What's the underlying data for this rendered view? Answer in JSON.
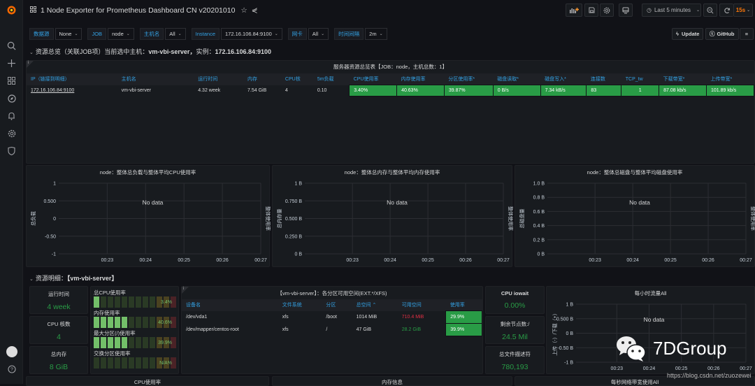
{
  "app": {
    "title": "1 Node Exporter for Prometheus Dashboard CN v20201010"
  },
  "toolbar": {
    "add_panel_icon": "add-panel-icon",
    "save_icon": "save-icon",
    "settings_icon": "gear-icon",
    "tv_icon": "tv-icon",
    "time_range": "Last 5 minutes",
    "zoom_out_icon": "zoom-out-icon",
    "refresh_icon": "refresh-icon",
    "refresh_interval": "15s",
    "refresh_color": "#ff780a"
  },
  "sidebar": {
    "items": [
      {
        "icon": "search-icon"
      },
      {
        "icon": "plus-icon"
      },
      {
        "icon": "dashboards-icon"
      },
      {
        "icon": "explore-icon"
      },
      {
        "icon": "bell-icon"
      },
      {
        "icon": "gear-icon"
      },
      {
        "icon": "shield-icon"
      }
    ],
    "bottom": [
      {
        "icon": "avatar"
      },
      {
        "icon": "help-icon"
      }
    ]
  },
  "variables": [
    {
      "label": "数据源",
      "value": "None"
    },
    {
      "label": "JOB",
      "value": "node"
    },
    {
      "label": "主机名",
      "value": "All"
    },
    {
      "label": "Instance",
      "value": "172.16.106.84:9100"
    },
    {
      "label": "网卡",
      "value": "All"
    },
    {
      "label": "时间间隔",
      "value": "2m"
    }
  ],
  "links": {
    "update": "Update",
    "github": "GitHub"
  },
  "row1": {
    "title_prefix": "资源总览（关联JOB项）当前选中主机：",
    "title_host": "vm-vbi-server，",
    "title_mid": "实例：",
    "title_instance": "172.16.106.84:9100"
  },
  "overview_table": {
    "title": "服务器资源总览表【JOB：node，主机总数：1】",
    "columns": [
      "IP（链接到明细）",
      "主机名",
      "运行时间",
      "内存",
      "CPU核",
      "5m负载",
      "CPU使用率",
      "内存使用率",
      "分区使用率*",
      "磁盘读取*",
      "磁盘写入*",
      "连接数",
      "TCP_tw",
      "下载带宽*",
      "上传带宽*"
    ],
    "rows": [
      [
        "172.16.106.84:9100",
        "vm-vbi-server",
        "4.32 week",
        "7.54 GiB",
        "4",
        "0.10",
        "3.40%",
        "40.63%",
        "39.87%",
        "0 B/s",
        "7.34 kB/s",
        "83",
        "1",
        "87.08 kb/s",
        "101.89 kb/s"
      ]
    ]
  },
  "chart_data": [
    {
      "type": "line",
      "title": "node：整体总负载与整体平均CPU使用率",
      "ylabel": "总负载",
      "y2label": "整体使用率",
      "yticks": [
        "1",
        "0.500",
        "0",
        "-0.50",
        "-1"
      ],
      "ylim": [
        -1,
        1
      ],
      "x": [
        "00:23",
        "00:24",
        "00:25",
        "00:26",
        "00:27"
      ],
      "series": [],
      "no_data": "No data"
    },
    {
      "type": "line",
      "title": "node：整体总内存与整体平均内存使用率",
      "ylabel": "总内存量",
      "y2label": "整体使用率",
      "yticks": [
        "1 B",
        "0.750 B",
        "0.500 B",
        "0.250 B",
        "0 B"
      ],
      "ylim": [
        0,
        1
      ],
      "x": [
        "00:23",
        "00:24",
        "00:25",
        "00:26",
        "00:27"
      ],
      "series": [],
      "no_data": "No data"
    },
    {
      "type": "line",
      "title": "node：整体总磁盘与整体平均磁盘使用率",
      "ylabel": "总磁盘量",
      "y2label": "整体使用率",
      "yticks": [
        "1.0 B",
        "0.8 B",
        "0.6 B",
        "0.4 B",
        "0.2 B",
        "0 B"
      ],
      "ylim": [
        0,
        1
      ],
      "x": [
        "00:23",
        "00:24",
        "00:25",
        "00:26",
        "00:27"
      ],
      "series": [],
      "no_data": "No data"
    },
    {
      "type": "line",
      "title": "每小时流量All",
      "ylabel": "上传（-）/下载（+）",
      "y2label": "",
      "yticks": [
        "1 B",
        "0.500 B",
        "0 B",
        "-0.50 B",
        "-1 B"
      ],
      "ylim": [
        -1,
        1
      ],
      "x": [
        "00:23",
        "00:24",
        "00:25",
        "00:26",
        "00:27"
      ],
      "series": [],
      "no_data": "No data"
    }
  ],
  "row2": {
    "title_prefix": "资源明细：",
    "title_host": "【vm-vbi-server】"
  },
  "stats": {
    "uptime": {
      "title": "运行时间",
      "value": "4 week"
    },
    "cpu_cores": {
      "title": "CPU 核数",
      "value": "4"
    },
    "total_mem": {
      "title": "总内存",
      "value": "8 GiB"
    },
    "iowait": {
      "title": "CPU iowait",
      "value": "0.00%"
    },
    "inodes": {
      "title": "剩余节点数:/",
      "value": "24.5 Mil"
    },
    "fds": {
      "title": "总文件描述符",
      "value": "780,193"
    }
  },
  "gauges": [
    {
      "label": "总CPU使用率",
      "value": "3.4%",
      "fraction": 0.034
    },
    {
      "label": "内存使用率",
      "value": "40.6%",
      "fraction": 0.406
    },
    {
      "label": "最大分区(/)使用率",
      "value": "39.9%",
      "fraction": 0.399
    },
    {
      "label": "交换分区使用率",
      "value": "N/A%",
      "fraction": 0
    }
  ],
  "partition_table": {
    "title": "【vm-vbi-server】：各分区可用空间(EXT.*/XFS)",
    "columns": [
      "设备名",
      "文件系统",
      "分区",
      "总空间 ⌃",
      "可用空间",
      "使用率"
    ],
    "rows": [
      [
        "/dev/vda1",
        "xfs",
        "/boot",
        "1014 MiB",
        "710.4 MiB",
        "29.9%"
      ],
      [
        "/dev/mapper/centos-root",
        "xfs",
        "/",
        "47 GiB",
        "28.2 GiB",
        "39.9%"
      ]
    ],
    "avail_colors": [
      "#e02f44",
      "#299c46"
    ]
  },
  "bottom_panels": [
    "CPU使用率",
    "内存信息",
    "每秒网络带宽使用All"
  ],
  "watermark": {
    "brand": "7DGroup",
    "url": "https://blog.csdn.net/zuozewei"
  }
}
